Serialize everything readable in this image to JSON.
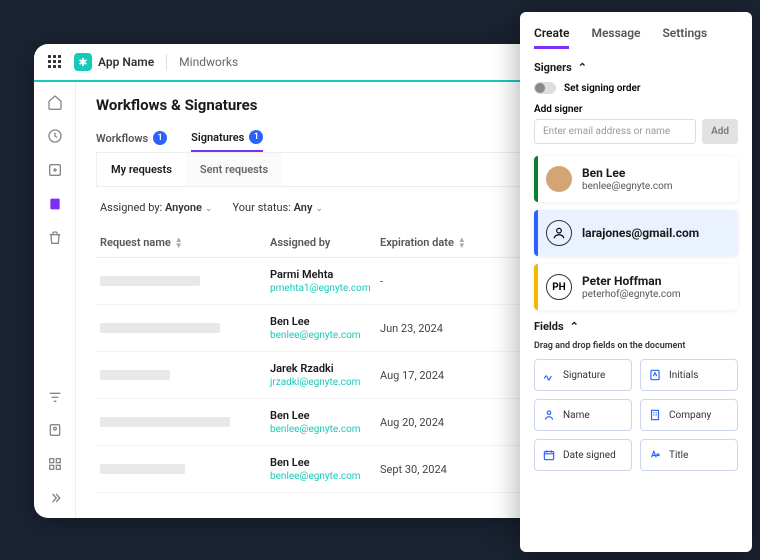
{
  "header": {
    "app_name": "App Name",
    "project": "Mindworks"
  },
  "page": {
    "title": "Workflows & Signatures"
  },
  "tabs": [
    {
      "label": "Workflows",
      "count": "1"
    },
    {
      "label": "Signatures",
      "count": "1"
    }
  ],
  "subtabs": {
    "a": "My requests",
    "b": "Sent requests"
  },
  "filters": {
    "assigned_label": "Assigned by:",
    "assigned_val": "Anyone",
    "status_label": "Your status:",
    "status_val": "Any"
  },
  "columns": {
    "c1": "Request name",
    "c2": "Assigned by",
    "c3": "Expiration date"
  },
  "rows": [
    {
      "name": "Parmi Mehta",
      "email": "pmehta1@egnyte.com",
      "date": "-"
    },
    {
      "name": "Ben Lee",
      "email": "benlee@egnyte.com",
      "date": "Jun 23, 2024"
    },
    {
      "name": "Jarek Rzadki",
      "email": "jrzadki@egnyte.com",
      "date": "Aug 17, 2024"
    },
    {
      "name": "Ben Lee",
      "email": "benlee@egnyte.com",
      "date": "Aug 20, 2024"
    },
    {
      "name": "Ben Lee",
      "email": "benlee@egnyte.com",
      "date": "Sept 30, 2024"
    }
  ],
  "panel": {
    "tabs": {
      "a": "Create",
      "b": "Message",
      "c": "Settings"
    },
    "section_signers": "Signers",
    "signing_order": "Set signing order",
    "add_signer_label": "Add signer",
    "add_placeholder": "Enter email address or name",
    "add_btn": "Add",
    "signers": [
      {
        "name": "Ben Lee",
        "email": "benlee@egnyte.com",
        "initials": ""
      },
      {
        "name": "",
        "email": "larajones@gmail.com",
        "initials": ""
      },
      {
        "name": "Peter Hoffman",
        "email": "peterhof@egnyte.com",
        "initials": "PH"
      }
    ],
    "section_fields": "Fields",
    "hint": "Drag and drop fields on the document",
    "fields": [
      {
        "label": "Signature"
      },
      {
        "label": "Initials"
      },
      {
        "label": "Name"
      },
      {
        "label": "Company"
      },
      {
        "label": "Date signed"
      },
      {
        "label": "Title"
      }
    ]
  }
}
